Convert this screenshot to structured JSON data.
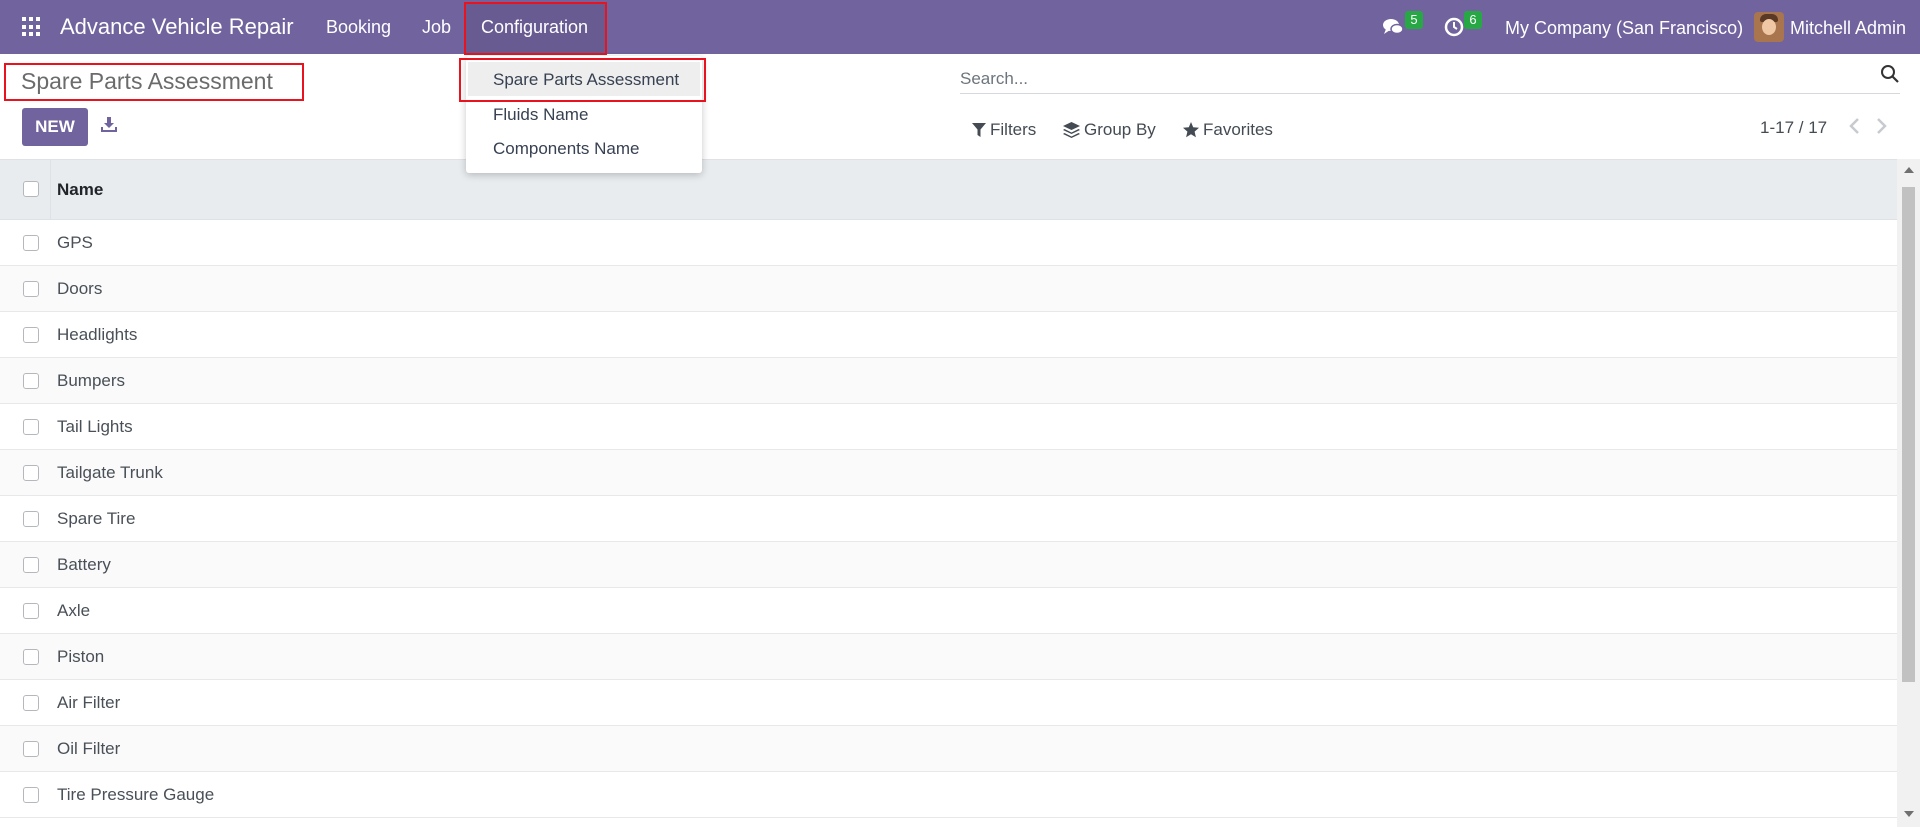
{
  "navbar": {
    "app_title": "Advance Vehicle Repair",
    "menu": [
      "Booking",
      "Job",
      "Configuration"
    ],
    "messages_count": "5",
    "activities_count": "6",
    "company": "My Company (San Francisco)",
    "user": "Mitchell Admin",
    "bg_color": "#71639e"
  },
  "dropdown": {
    "items": [
      "Spare Parts Assessment",
      "Fluids Name",
      "Components Name"
    ],
    "active": "Spare Parts Assessment"
  },
  "control_panel": {
    "page_title": "Spare Parts Assessment",
    "new_label": "NEW",
    "search_placeholder": "Search...",
    "filters_label": "Filters",
    "groupby_label": "Group By",
    "favorites_label": "Favorites",
    "pager": "1-17 / 17"
  },
  "table": {
    "header": "Name",
    "rows": [
      "GPS",
      "Doors",
      "Headlights",
      "Bumpers",
      "Tail Lights",
      "Tailgate Trunk",
      "Spare Tire",
      "Battery",
      "Axle",
      "Piston",
      "Air Filter",
      "Oil Filter",
      "Tire Pressure Gauge"
    ]
  },
  "highlight_color": "#e8131f",
  "icons": [
    "apps-grid-icon",
    "chat-icon",
    "clock-icon",
    "download-icon",
    "search-icon",
    "filter-icon",
    "layers-icon",
    "star-icon",
    "chevron-left-icon",
    "chevron-right-icon"
  ]
}
